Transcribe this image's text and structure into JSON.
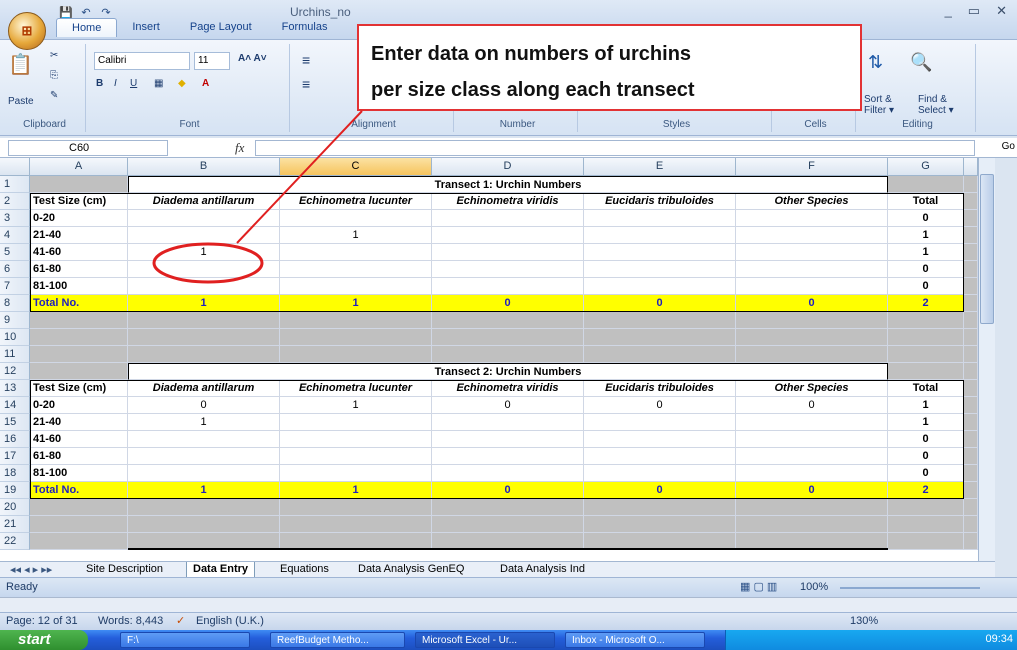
{
  "window": {
    "title": "Urchins_no",
    "controls": [
      "_",
      "▭",
      "✕"
    ]
  },
  "ribbon": {
    "tabs": [
      "Home",
      "Insert",
      "Page Layout",
      "Formulas"
    ],
    "font_name": "Calibri",
    "font_size": "11",
    "groups": {
      "clipboard": "Clipboard",
      "font": "Font",
      "alignment": "Alignment",
      "number": "Number",
      "styles": "Styles",
      "cells": "Cells",
      "editing": "Editing"
    },
    "paste": "Paste",
    "sort_filter": "Sort & Filter ▾",
    "find_select": "Find & Select ▾"
  },
  "callout": {
    "line1": "Enter data on numbers of urchins",
    "line2": "per size class along each transect"
  },
  "formula_bar": {
    "name_box": "C60",
    "fx": "fx",
    "go": "Go"
  },
  "columns": [
    "A",
    "B",
    "C",
    "D",
    "E",
    "F",
    "G"
  ],
  "rows": [
    "1",
    "2",
    "3",
    "4",
    "5",
    "6",
    "7",
    "8",
    "9",
    "10",
    "11",
    "12",
    "13",
    "14",
    "15",
    "16",
    "17",
    "18",
    "19",
    "20",
    "21",
    "22"
  ],
  "transect1": {
    "title": "Transect 1: Urchin Numbers",
    "header": [
      "Test Size (cm)",
      "Diadema antillarum",
      "Echinometra lucunter",
      "Echinometra viridis",
      "Eucidaris tribuloides",
      "Other Species",
      "Total"
    ],
    "rows": [
      [
        "0-20",
        "",
        "",
        "",
        "",
        "",
        "0"
      ],
      [
        "21-40",
        "",
        "1",
        "",
        "",
        "",
        "1"
      ],
      [
        "41-60",
        "1",
        "",
        "",
        "",
        "",
        "1"
      ],
      [
        "61-80",
        "",
        "",
        "",
        "",
        "",
        "0"
      ],
      [
        "81-100",
        "",
        "",
        "",
        "",
        "",
        "0"
      ]
    ],
    "total": [
      "Total No.",
      "1",
      "1",
      "0",
      "0",
      "0",
      "2"
    ]
  },
  "transect2": {
    "title": "Transect 2: Urchin Numbers",
    "header": [
      "Test Size (cm)",
      "Diadema antillarum",
      "Echinometra lucunter",
      "Echinometra viridis",
      "Eucidaris tribuloides",
      "Other Species",
      "Total"
    ],
    "rows": [
      [
        "0-20",
        "0",
        "1",
        "0",
        "0",
        "0",
        "1"
      ],
      [
        "21-40",
        "1",
        "",
        "",
        "",
        "",
        "1"
      ],
      [
        "41-60",
        "",
        "",
        "",
        "",
        "",
        "0"
      ],
      [
        "61-80",
        "",
        "",
        "",
        "",
        "",
        "0"
      ],
      [
        "81-100",
        "",
        "",
        "",
        "",
        "",
        "0"
      ]
    ],
    "total": [
      "Total No.",
      "1",
      "1",
      "0",
      "0",
      "0",
      "2"
    ]
  },
  "sheet_tabs": [
    "Site Description",
    "Data Entry",
    "Equations",
    "Data Analysis GenEQ",
    "Data Analysis Ind"
  ],
  "status": {
    "ready": "Ready",
    "zoom": "100%"
  },
  "word_status": {
    "page": "Page: 12 of 31",
    "words": "Words: 8,443",
    "language": "English (U.K.)",
    "zoom": "130%"
  },
  "taskbar": {
    "start": "start",
    "items": [
      "F:\\",
      "ReefBudget Metho...",
      "Microsoft Excel - Ur...",
      "Inbox - Microsoft O..."
    ],
    "clock": "09:34"
  }
}
